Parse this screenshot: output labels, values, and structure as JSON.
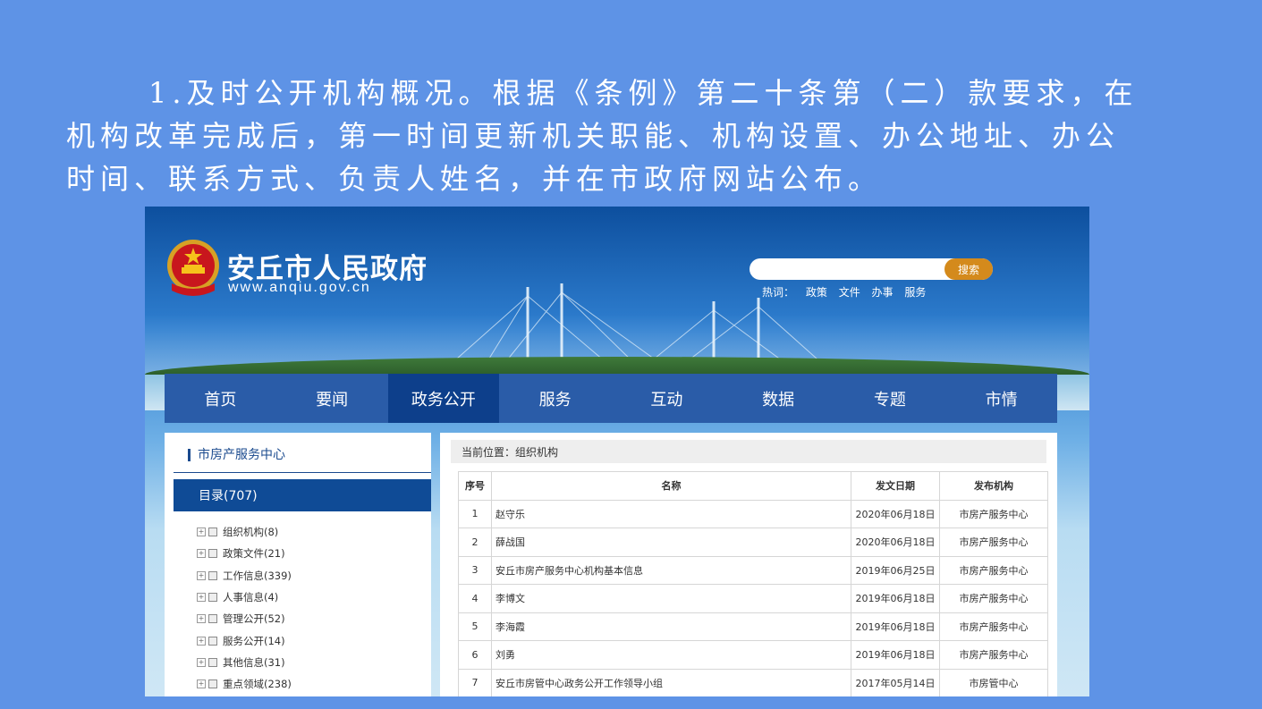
{
  "intro": {
    "line1": "1.及时公开机构概况。根据《条例》第二十条第（二）款要求，在",
    "line2": "机构改革完成后，第一时间更新机关职能、机构设置、办公地址、办公",
    "line3": "时间、联系方式、负责人姓名，并在市政府网站公布。"
  },
  "site": {
    "title": "安丘市人民政府",
    "url": "www.anqiu.gov.cn"
  },
  "search": {
    "placeholder": "",
    "button": "搜索",
    "hot_label": "热词：",
    "hot_words": [
      "政策",
      "文件",
      "办事",
      "服务"
    ]
  },
  "nav": [
    "首页",
    "要闻",
    "政务公开",
    "服务",
    "互动",
    "数据",
    "专题",
    "市情"
  ],
  "sidebar": {
    "title": "市房产服务中心",
    "catalog": "目录(707)",
    "items": [
      "组织机构(8)",
      "政策文件(21)",
      "工作信息(339)",
      "人事信息(4)",
      "管理公开(52)",
      "服务公开(14)",
      "其他信息(31)",
      "重点领域(238)"
    ]
  },
  "breadcrumb": "当前位置：组织机构",
  "table": {
    "headers": [
      "序号",
      "名称",
      "发文日期",
      "发布机构"
    ],
    "rows": [
      [
        "1",
        "赵守乐",
        "2020年06月18日",
        "市房产服务中心"
      ],
      [
        "2",
        "薛战国",
        "2020年06月18日",
        "市房产服务中心"
      ],
      [
        "3",
        "安丘市房产服务中心机构基本信息",
        "2019年06月25日",
        "市房产服务中心"
      ],
      [
        "4",
        "李博文",
        "2019年06月18日",
        "市房产服务中心"
      ],
      [
        "5",
        "李海霞",
        "2019年06月18日",
        "市房产服务中心"
      ],
      [
        "6",
        "刘勇",
        "2019年06月18日",
        "市房产服务中心"
      ],
      [
        "7",
        "安丘市房管中心政务公开工作领导小组",
        "2017年05月14日",
        "市房管中心"
      ]
    ]
  },
  "colors": {
    "background": "#5e93e6",
    "nav": "#2a5ca8",
    "nav_active": "#0d3f8b",
    "search_button": "#d48a1c"
  }
}
